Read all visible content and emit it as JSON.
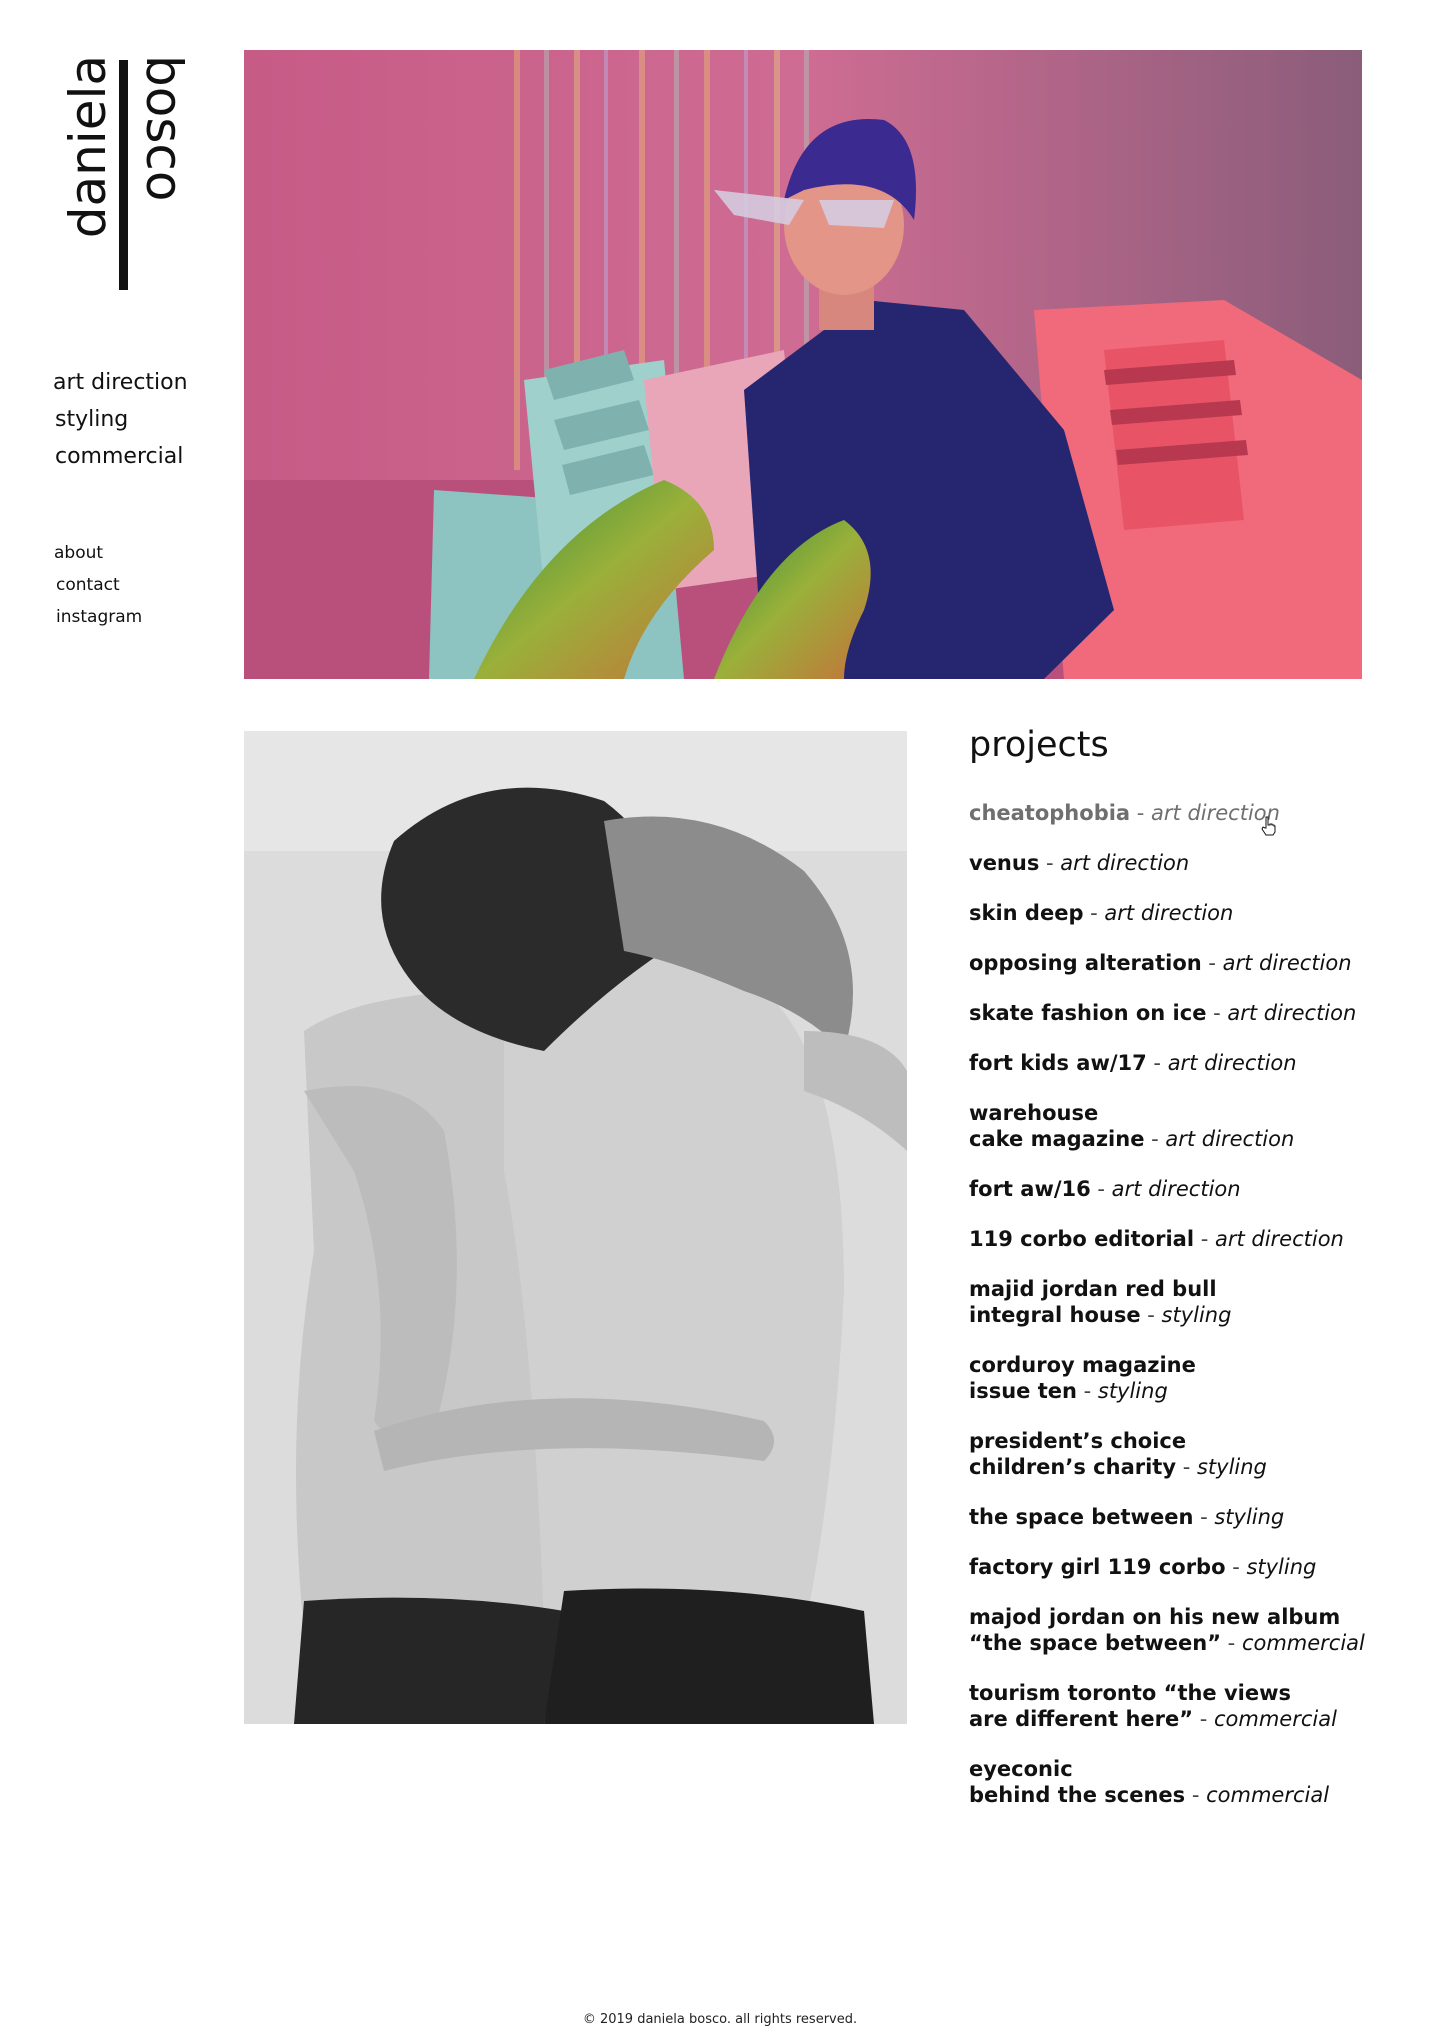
{
  "logo": {
    "first_name": "daniela",
    "last_name": "bosco"
  },
  "category_nav": [
    "art direction",
    "styling",
    "commercial"
  ],
  "info_nav": [
    "about",
    "contact",
    "instagram"
  ],
  "projects": {
    "heading": "projects",
    "separator": " - ",
    "items": [
      {
        "line1": "cheatophobia",
        "line2": "",
        "category": "art direction",
        "hover": true
      },
      {
        "line1": "venus",
        "line2": "",
        "category": "art direction"
      },
      {
        "line1": "skin deep",
        "line2": "",
        "category": "art direction"
      },
      {
        "line1": "opposing alteration",
        "line2": "",
        "category": "art direction"
      },
      {
        "line1": "skate fashion on ice",
        "line2": "",
        "category": "art direction"
      },
      {
        "line1": "fort kids aw/17",
        "line2": "",
        "category": "art direction"
      },
      {
        "line1": "warehouse",
        "line2": "cake magazine",
        "category": "art direction"
      },
      {
        "line1": "fort aw/16",
        "line2": "",
        "category": "art direction"
      },
      {
        "line1": "119 corbo editorial",
        "line2": "",
        "category": "art direction"
      },
      {
        "line1": "majid jordan red bull",
        "line2": "integral house",
        "category": "styling"
      },
      {
        "line1": "corduroy magazine",
        "line2": "issue ten",
        "category": "styling"
      },
      {
        "line1": "president’s choice",
        "line2": "children’s charity",
        "category": "styling"
      },
      {
        "line1": "the space between",
        "line2": "",
        "category": "styling"
      },
      {
        "line1": "factory girl 119 corbo",
        "line2": "",
        "category": "styling"
      },
      {
        "line1": "majod jordan on his new album",
        "line2": "“the space between”",
        "category": "commercial"
      },
      {
        "line1": "tourism toronto “the views",
        "line2": "are different here”",
        "category": "commercial"
      },
      {
        "line1": "eyeconic",
        "line2": "behind the scenes",
        "category": "commercial"
      }
    ]
  },
  "footer": {
    "copyright": "© 2019 daniela bosco. all rights reserved."
  },
  "colors": {
    "text": "#111111",
    "hover": "#6f6f6f",
    "background": "#ffffff"
  }
}
